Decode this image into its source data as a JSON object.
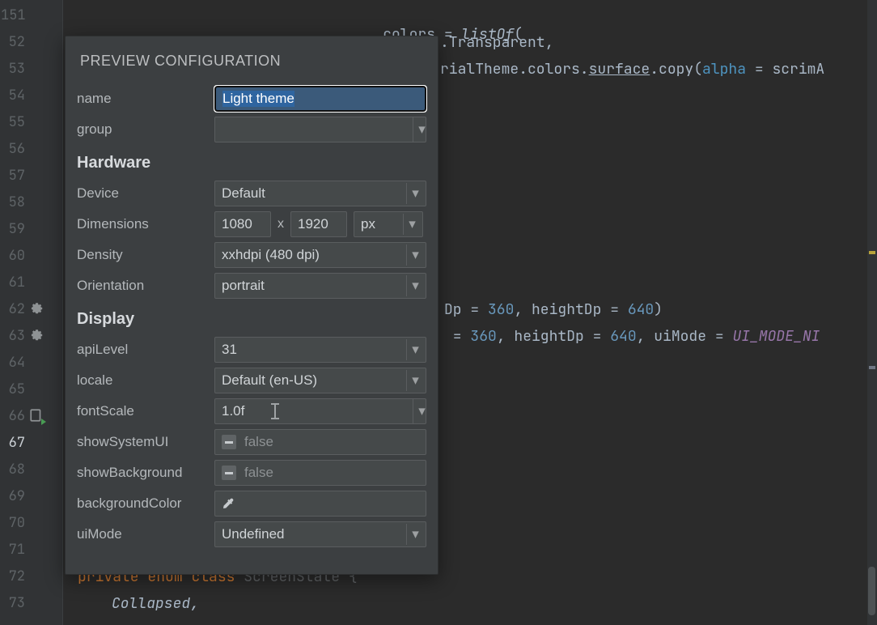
{
  "code": {
    "l151": {
      "ident": "colors",
      "eq": " = ",
      "fn": "listOf",
      "paren": "("
    },
    "l152": {
      "tail": ".Transparent,"
    },
    "l153": {
      "pre": "rialTheme.colors.",
      "surface": "surface",
      "mid": ".copy(",
      "named": "alpha",
      "eq2": " = ",
      "tail2": "scrimA"
    },
    "l162": {
      "pre": "Dp = ",
      "w": "360",
      "mid": ", heightDp = ",
      "h": "640",
      "end": ")"
    },
    "l163": {
      "pre": " = ",
      "w": "360",
      "mid": ", heightDp = ",
      "h": "640",
      "mid2": ", uiMode = ",
      "const": "UI_MODE_NI"
    },
    "l172": {
      "kw1": "private",
      "kw2": "enum",
      "kw3": "class",
      "name": "ScreenState",
      "brace": " {"
    },
    "l173": {
      "item": "Collapsed",
      "comma": ","
    }
  },
  "line_numbers": [
    "151",
    "52",
    "53",
    "54",
    "55",
    "56",
    "57",
    "58",
    "59",
    "60",
    "61",
    "62",
    "63",
    "64",
    "65",
    "66",
    "67",
    "68",
    "69",
    "70",
    "71",
    "72",
    "73"
  ],
  "current_line_index": 16,
  "panel": {
    "title": "PREVIEW CONFIGURATION",
    "name_label": "name",
    "name_value": "Light theme",
    "group_label": "group",
    "group_value": "",
    "hardware_head": "Hardware",
    "device_label": "Device",
    "device_value": "Default",
    "dimensions_label": "Dimensions",
    "dim_w": "1080",
    "dim_sep": "x",
    "dim_h": "1920",
    "dim_unit": "px",
    "density_label": "Density",
    "density_value": "xxhdpi (480 dpi)",
    "orientation_label": "Orientation",
    "orientation_value": "portrait",
    "display_head": "Display",
    "api_label": "apiLevel",
    "api_value": "31",
    "locale_label": "locale",
    "locale_value": "Default (en-US)",
    "fontscale_label": "fontScale",
    "fontscale_value": "1.0f",
    "showsysui_label": "showSystemUI",
    "showsysui_value": "false",
    "showbg_label": "showBackground",
    "showbg_value": "false",
    "bgcolor_label": "backgroundColor",
    "bgcolor_value": "",
    "uimode_label": "uiMode",
    "uimode_value": "Undefined",
    "caret": "▾"
  }
}
